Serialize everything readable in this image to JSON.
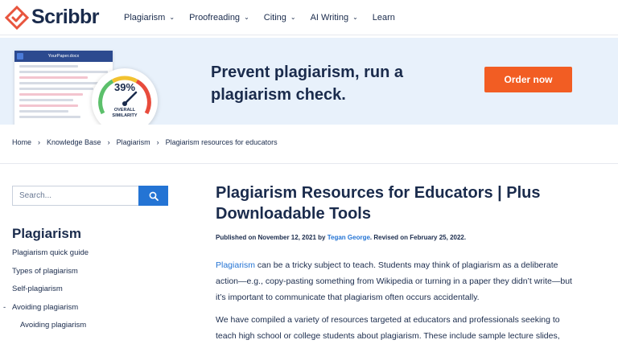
{
  "logo": {
    "text": "Scribbr",
    "color": "#e8553e"
  },
  "nav": [
    {
      "label": "Plagiarism",
      "dropdown": true
    },
    {
      "label": "Proofreading",
      "dropdown": true
    },
    {
      "label": "Citing",
      "dropdown": true
    },
    {
      "label": "AI Writing",
      "dropdown": true
    },
    {
      "label": "Learn",
      "dropdown": false
    }
  ],
  "banner": {
    "doc_title": "YourPaper.docx",
    "gauge_percent": "39%",
    "gauge_label_1": "OVERALL",
    "gauge_label_2": "SIMILARITY",
    "headline_1": "Prevent plagiarism, run a",
    "headline_2": "plagiarism check.",
    "cta": "Order now",
    "cta_color": "#f25d23"
  },
  "breadcrumb": [
    "Home",
    "Knowledge Base",
    "Plagiarism",
    "Plagiarism resources for educators"
  ],
  "sidebar": {
    "search_placeholder": "Search...",
    "title": "Plagiarism",
    "items": [
      {
        "label": "Plagiarism quick guide",
        "sub": false,
        "expanded": false
      },
      {
        "label": "Types of plagiarism",
        "sub": false,
        "expanded": false
      },
      {
        "label": "Self-plagiarism",
        "sub": false,
        "expanded": false
      },
      {
        "label": "Avoiding plagiarism",
        "sub": false,
        "expanded": true
      },
      {
        "label": "Avoiding plagiarism",
        "sub": true,
        "expanded": false
      }
    ]
  },
  "article": {
    "title_1": "Plagiarism Resources for Educators | Plus",
    "title_2": "Downloadable Tools",
    "byline_prefix": "Published on November 12, 2021 by ",
    "author": "Tegan George",
    "byline_suffix": ". Revised on February 25, 2022.",
    "p1_link": "Plagiarism",
    "p1_line1_rest": " can be a tricky subject to teach. Students may think of plagiarism as a deliberate",
    "p1_line2": "action—e.g., copy-pasting something from Wikipedia or turning in a paper they didn’t write—but",
    "p1_line3": "it’s important to communicate that plagiarism often occurs accidentally.",
    "p2_line1": "We have compiled a variety of resources targeted at educators and professionals seeking to",
    "p2_line2": "teach high school or college students about plagiarism. These include sample lecture slides,"
  },
  "colors": {
    "accent_blue": "#2474d4",
    "navy": "#1a2b4c",
    "banner_bg": "#e8f1fb"
  }
}
